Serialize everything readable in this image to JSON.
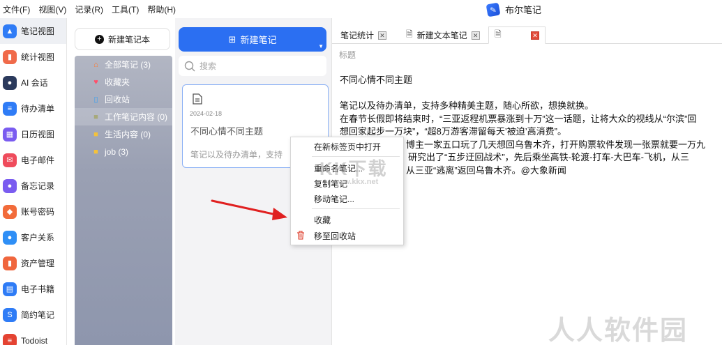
{
  "menubar": {
    "items": [
      "文件(F)",
      "视图(V)",
      "记录(R)",
      "工具(T)",
      "帮助(H)"
    ],
    "app_title": "布尔笔记"
  },
  "leftnav": {
    "items": [
      {
        "label": "笔记视图",
        "icon": "notes-view-icon",
        "color": "#2f7cf6",
        "glyph": "▲"
      },
      {
        "label": "统计视图",
        "icon": "stats-view-icon",
        "color": "#f06a4a",
        "glyph": "▮"
      },
      {
        "label": "AI 会话",
        "icon": "ai-chat-icon",
        "color": "#2b3a5c",
        "glyph": "●"
      },
      {
        "label": "待办清单",
        "icon": "todo-list-icon",
        "color": "#2f7cf6",
        "glyph": "≡"
      },
      {
        "label": "日历视图",
        "icon": "calendar-view-icon",
        "color": "#7a5cf0",
        "glyph": "▦"
      },
      {
        "label": "电子邮件",
        "icon": "email-icon",
        "color": "#ef4c5c",
        "glyph": "✉"
      },
      {
        "label": "备忘记录",
        "icon": "memo-icon",
        "color": "#7a5cf0",
        "glyph": "●"
      },
      {
        "label": "账号密码",
        "icon": "account-password-icon",
        "color": "#f26b3a",
        "glyph": "◆"
      },
      {
        "label": "客户关系",
        "icon": "customer-relations-icon",
        "color": "#2f8ff6",
        "glyph": "●"
      },
      {
        "label": "资产管理",
        "icon": "asset-management-icon",
        "color": "#f0663d",
        "glyph": "▮"
      },
      {
        "label": "电子书籍",
        "icon": "ebook-icon",
        "color": "#2f7cf6",
        "glyph": "▤"
      },
      {
        "label": "简约笔记",
        "icon": "simple-notes-icon",
        "color": "#2f7cf6",
        "glyph": "S"
      },
      {
        "label": "Todoist",
        "icon": "todoist-icon",
        "color": "#e44332",
        "glyph": "≡"
      }
    ]
  },
  "tree": {
    "new_notebook_label": "新建笔记本",
    "items": [
      {
        "label": "全部笔记 (3)",
        "icon": "home-icon",
        "icon_color": "#ff7a2f"
      },
      {
        "label": "收藏夹",
        "icon": "favorites-icon",
        "icon_color": "#ff4f6a"
      },
      {
        "label": "回收站",
        "icon": "recycle-bin-icon",
        "icon_color": "#3aa0f0"
      },
      {
        "label": "工作笔记内容 (0)",
        "icon": "folder-icon",
        "icon_color": "#a7a97a"
      },
      {
        "label": "生活内容 (0)",
        "icon": "folder-icon",
        "icon_color": "#f5c23a"
      },
      {
        "label": "job (3)",
        "icon": "folder-icon",
        "icon_color": "#f5c23a"
      }
    ],
    "selected_index": 3
  },
  "notelist": {
    "new_note_label": "新建笔记",
    "search_placeholder": "搜索",
    "card": {
      "date": "2024-02-18",
      "title": "不同心情不同主题",
      "snippet": "笔记以及待办清单，支持"
    }
  },
  "editor": {
    "tabs": [
      {
        "label": "笔记统计",
        "has_doc_icon": false
      },
      {
        "label": "新建文本笔记",
        "has_doc_icon": true
      },
      {
        "label": "",
        "has_doc_icon": true
      }
    ],
    "title_placeholder": "标题",
    "lines": [
      "不同心情不同主题",
      "",
      "笔记以及待办清单，支持多种精美主题，随心所欲，想换就换。",
      "在春节长假即将结束时，“三亚返程机票暴涨到十万”这一话题，让将大众的视线从“尔滨”回",
      "想回家起步一万块”，“超8万游客滞留每天’被迫’高消费”。",
      "博主一家五口玩了几天想回乌鲁木齐，打开购票软件发现一张票就要一万九",
      "，研究出了“五步迂回战术”，先后乘坐高铁-轮渡-打车-大巴车-飞机，从三",
      "从三亚“逃离”返回乌鲁木齐。@大象新闻"
    ]
  },
  "context_menu": {
    "items": [
      {
        "label": "在新标签页中打开",
        "group": 0
      },
      {
        "label": "重命名笔记...",
        "group": 1
      },
      {
        "label": "复制笔记",
        "group": 1
      },
      {
        "label": "移动笔记...",
        "group": 1
      },
      {
        "label": "收藏",
        "group": 2
      },
      {
        "label": "移至回收站",
        "group": 2
      }
    ]
  },
  "watermarks": {
    "center_big": "KK下载",
    "center_small": "www.kkx.net",
    "bottom_right": "人人软件园"
  },
  "colors": {
    "accent": "#2b6ff2",
    "arrow": "#e02020",
    "close_red": "#e04b3a"
  }
}
